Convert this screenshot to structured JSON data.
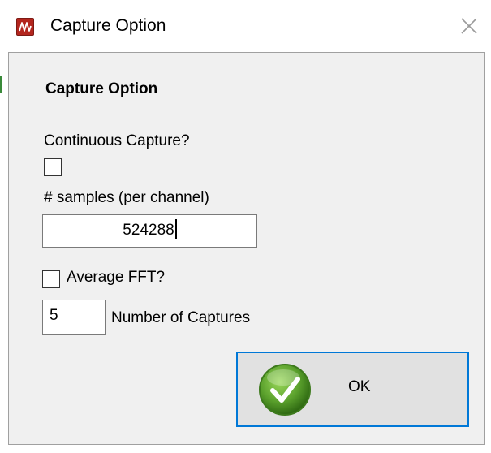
{
  "window": {
    "title": "Capture Option",
    "icon": "waveform-app-icon",
    "close_icon": "close-icon"
  },
  "form": {
    "heading": "Capture Option",
    "continuous_capture": {
      "label": "Continuous Capture?",
      "checked": false
    },
    "samples": {
      "label": "# samples (per channel)",
      "value": "524288"
    },
    "average_fft": {
      "label": "Average FFT?",
      "checked": false
    },
    "captures": {
      "value": "5",
      "label": "Number of Captures"
    },
    "ok_button": {
      "label": "OK",
      "icon": "checkmark-icon"
    }
  },
  "colors": {
    "dialog_background": "#f0f0f0",
    "focus_border": "#0078d7",
    "button_face": "#e1e1e1",
    "checkmark_green": "#5aa02c",
    "app_icon_red": "#b3261e"
  }
}
